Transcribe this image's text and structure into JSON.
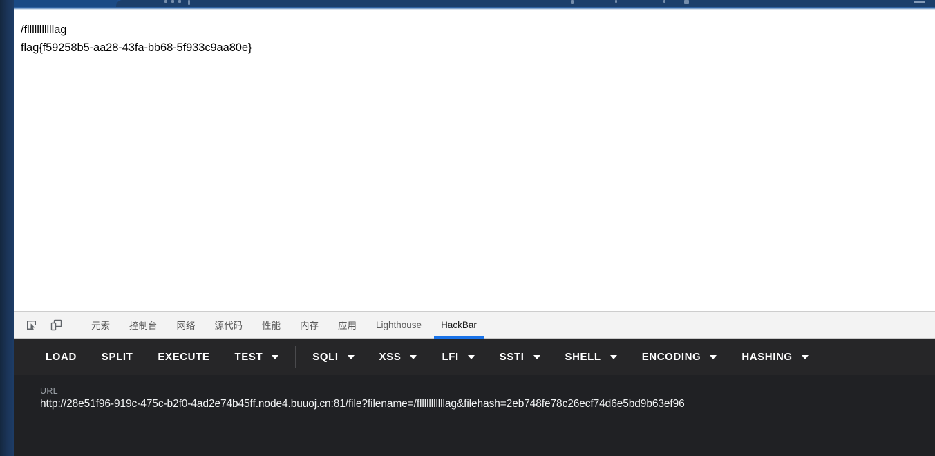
{
  "browser": {
    "window_edge_color": "#1b3559",
    "tabstrip_color": "#1d4d8c",
    "active_tab_color": "#1c3f6b"
  },
  "page": {
    "line1": "/flllllllllllag",
    "line2": "flag{f59258b5-aa28-43fa-bb68-5f933c9aa80e}"
  },
  "devtools": {
    "icons": [
      {
        "name": "inspect-element-icon",
        "title": "Inspect"
      },
      {
        "name": "device-toolbar-icon",
        "title": "Toggle device toolbar"
      }
    ],
    "tabs": [
      {
        "label": "元素",
        "active": false
      },
      {
        "label": "控制台",
        "active": false
      },
      {
        "label": "网络",
        "active": false
      },
      {
        "label": "源代码",
        "active": false
      },
      {
        "label": "性能",
        "active": false
      },
      {
        "label": "内存",
        "active": false
      },
      {
        "label": "应用",
        "active": false
      },
      {
        "label": "Lighthouse",
        "active": false
      },
      {
        "label": "HackBar",
        "active": true
      }
    ],
    "active_tab": "HackBar",
    "accent_color": "#1a73e8"
  },
  "hackbar": {
    "buttons": [
      {
        "label": "LOAD",
        "has_dropdown": false
      },
      {
        "label": "SPLIT",
        "has_dropdown": false
      },
      {
        "label": "EXECUTE",
        "has_dropdown": false
      },
      {
        "label": "TEST",
        "has_dropdown": true
      },
      {
        "label": "SQLI",
        "has_dropdown": true
      },
      {
        "label": "XSS",
        "has_dropdown": true
      },
      {
        "label": "LFI",
        "has_dropdown": true
      },
      {
        "label": "SSTI",
        "has_dropdown": true
      },
      {
        "label": "SHELL",
        "has_dropdown": true
      },
      {
        "label": "ENCODING",
        "has_dropdown": true
      },
      {
        "label": "HASHING",
        "has_dropdown": true
      }
    ],
    "url_field": {
      "label": "URL",
      "value": "http://28e51f96-919c-475c-b2f0-4ad2e74b45ff.node4.buuoj.cn:81/file?filename=/flllllllllllag&filehash=2eb748fe78c26ecf74d6e5bd9b63ef96"
    },
    "background_color": "#202124",
    "toolbar_color": "#262628"
  }
}
